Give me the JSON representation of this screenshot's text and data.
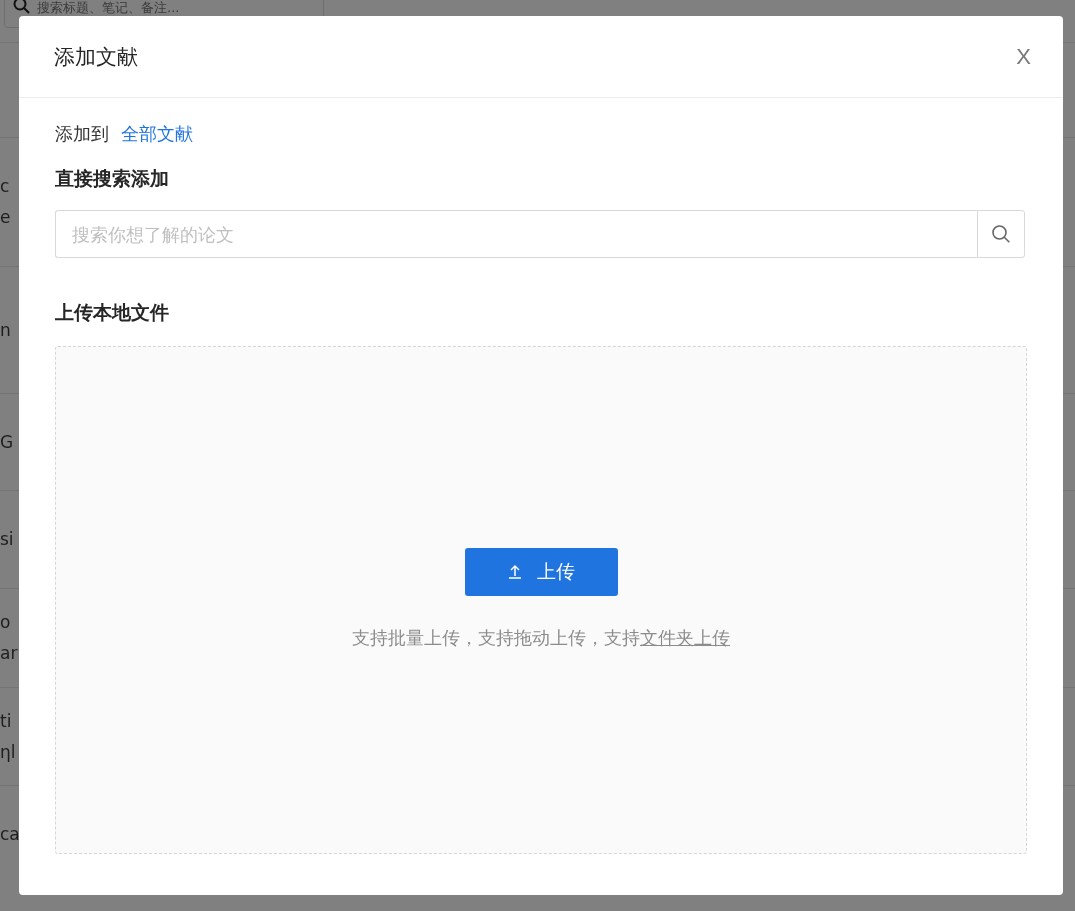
{
  "background": {
    "search": {
      "placeholder": "搜索标题、笔记、备注..."
    },
    "rows": [
      {
        "lines": []
      },
      {
        "lines": [
          "c",
          "e"
        ]
      },
      {
        "lines": [
          "n"
        ]
      },
      {
        "lines": [
          "G"
        ]
      },
      {
        "lines": [
          "si"
        ]
      },
      {
        "lines": [
          "o",
          "ar"
        ]
      },
      {
        "lines": [
          "ti",
          "ηl"
        ]
      },
      {
        "lines": [
          "ca"
        ]
      }
    ]
  },
  "dialog": {
    "title": "添加文献",
    "close": "X",
    "target": {
      "label": "添加到",
      "link": "全部文献"
    },
    "search_section": {
      "heading": "直接搜索添加",
      "placeholder": "搜索你想了解的论文"
    },
    "upload_section": {
      "heading": "上传本地文件",
      "button": "上传",
      "hint": "支持批量上传，支持拖动上传，支持",
      "hint_link": "文件夹上传"
    }
  }
}
